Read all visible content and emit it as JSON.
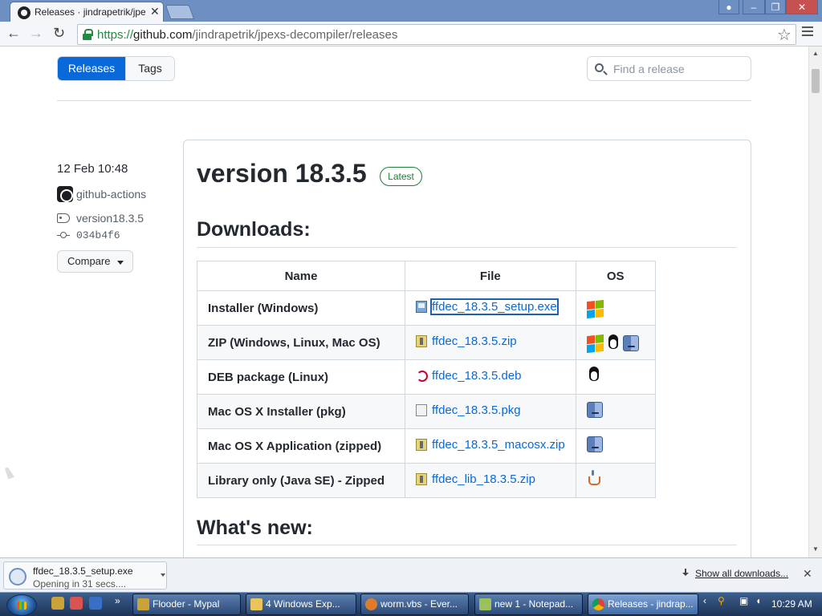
{
  "browser": {
    "tab_title": "Releases · jindrapetrik/jpe...",
    "url_scheme": "https://",
    "url_host": "github.com",
    "url_path": "/jindrapetrik/jpexs-decompiler/releases"
  },
  "nav": {
    "releases_label": "Releases",
    "tags_label": "Tags",
    "find_placeholder": "Find a release"
  },
  "release": {
    "date": "12 Feb 10:48",
    "author": "github-actions",
    "tag": "version18.3.5",
    "commit": "034b4f6",
    "compare_label": "Compare",
    "title": "version 18.3.5",
    "badge": "Latest",
    "downloads_heading": "Downloads:",
    "whats_new_heading": "What's new:"
  },
  "downloads": {
    "headers": [
      "Name",
      "File",
      "OS"
    ],
    "rows": [
      {
        "name": "Installer (Windows)",
        "file": "ffdec_18.3.5_setup.exe",
        "file_icon": "exe-icon",
        "os": [
          "windows-icon"
        ]
      },
      {
        "name": "ZIP (Windows, Linux, Mac OS)",
        "file": "ffdec_18.3.5.zip",
        "file_icon": "zip-icon",
        "os": [
          "windows-icon",
          "linux-icon",
          "mac-icon"
        ]
      },
      {
        "name": "DEB package (Linux)",
        "file": "ffdec_18.3.5.deb",
        "file_icon": "deb-icon",
        "os": [
          "linux-icon"
        ]
      },
      {
        "name": "Mac OS X Installer (pkg)",
        "file": "ffdec_18.3.5.pkg",
        "file_icon": "pkg-icon",
        "os": [
          "mac-icon"
        ]
      },
      {
        "name": "Mac OS X Application (zipped)",
        "file": "ffdec_18.3.5_macosx.zip",
        "file_icon": "zip-icon",
        "os": [
          "mac-icon"
        ]
      },
      {
        "name": "Library only (Java SE) - Zipped",
        "file": "ffdec_lib_18.3.5.zip",
        "file_icon": "zip-icon",
        "os": [
          "java-icon"
        ]
      }
    ]
  },
  "download_shelf": {
    "file": "ffdec_18.3.5_setup.exe",
    "status": "Opening in 31 secs....",
    "show_all": "Show all downloads..."
  },
  "taskbar": {
    "tasks": [
      "Flooder - Mypal",
      "4 Windows Exp...",
      "worm.vbs - Ever...",
      "new 1 - Notepad...",
      "Releases - jindrap..."
    ],
    "clock": "10:29 AM"
  },
  "colors": {
    "primary": "#0969da",
    "latest_green": "#1a7f37",
    "chrome_blue": "#6d8fc2"
  }
}
